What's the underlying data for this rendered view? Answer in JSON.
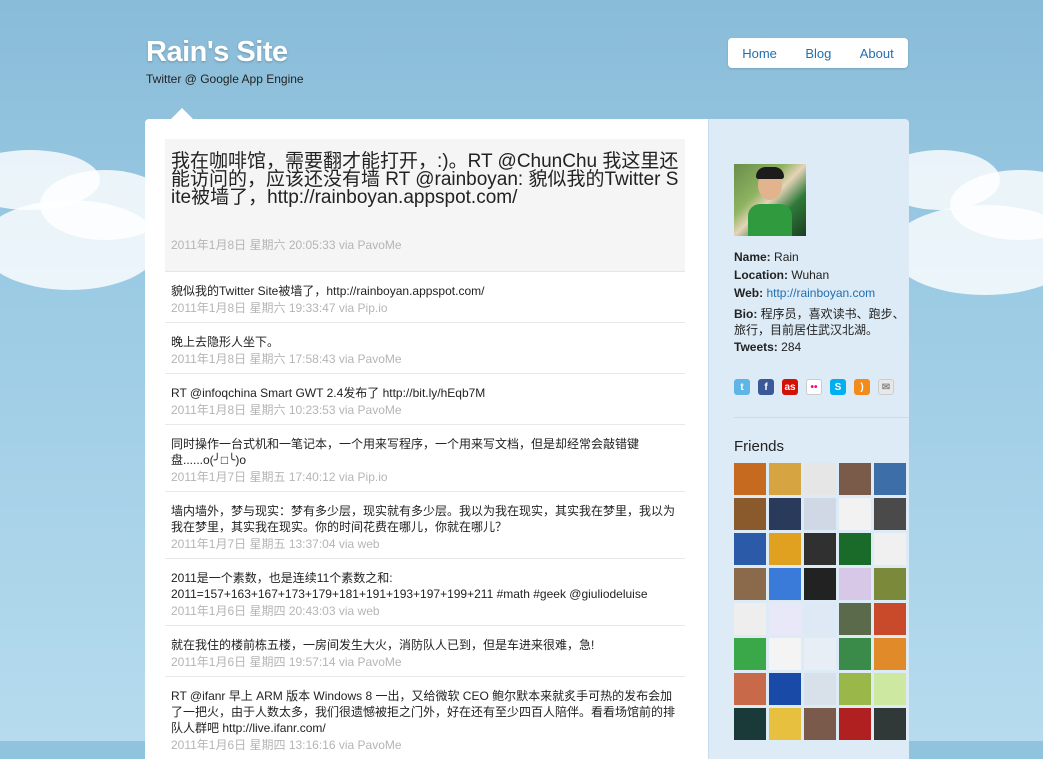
{
  "site": {
    "title": "Rain's Site",
    "subtitle": "Twitter @ Google App Engine"
  },
  "nav": [
    "Home",
    "Blog",
    "About"
  ],
  "featured": {
    "text": "我在咖啡馆，需要翻才能打开，:)。RT @ChunChu 我这里还能访问的，应该还没有墙 RT @rainboyan: 貌似我的Twitter Site被墙了，http://rainboyan.appspot.com/",
    "meta": "2011年1月8日 星期六 20:05:33 via PavoMe"
  },
  "tweets": [
    {
      "text": "貌似我的Twitter Site被墙了，http://rainboyan.appspot.com/",
      "meta": "2011年1月8日 星期六 19:33:47 via Pip.io"
    },
    {
      "text": "晚上去隐形人坐下。",
      "meta": "2011年1月8日 星期六 17:58:43 via PavoMe"
    },
    {
      "text": "RT @infoqchina Smart GWT 2.4发布了 http://bit.ly/hEqb7M",
      "meta": "2011年1月8日 星期六 10:23:53 via PavoMe"
    },
    {
      "text": "同时操作一台式机和一笔记本，一个用来写程序，一个用来写文档，但是却经常会敲错键盘......o(╯□╰)o",
      "meta": "2011年1月7日 星期五 17:40:12 via Pip.io"
    },
    {
      "text": "墙内墙外，梦与现实：梦有多少层，现实就有多少层。我以为我在现实，其实我在梦里，我以为我在梦里，其实我在现实。你的时间花费在哪儿，你就在哪儿？",
      "meta": "2011年1月7日 星期五 13:37:04 via web"
    },
    {
      "text": "2011是一个素数，也是连续11个素数之和: 2011=157+163+167+173+179+181+191+193+197+199+211 #math #geek @giuliodeluise",
      "meta": "2011年1月6日 星期四 20:43:03 via web"
    },
    {
      "text": "就在我住的楼前栋五楼，一房间发生大火，消防队人已到，但是车进来很难，急!",
      "meta": "2011年1月6日 星期四 19:57:14 via PavoMe"
    },
    {
      "text": "RT @ifanr 早上 ARM 版本 Windows 8 一出，又给微软 CEO 鲍尔默本来就炙手可热的发布会加了一把火，由于人数太多，我们很遗憾被拒之门外，好在还有至少四百人陪伴。看看场馆前的排队人群吧 http://live.ifanr.com/",
      "meta": "2011年1月6日 星期四 13:16:16 via PavoMe"
    }
  ],
  "profile": {
    "name_label": "Name:",
    "name": "Rain",
    "location_label": "Location:",
    "location": "Wuhan",
    "web_label": "Web:",
    "web": "http://rainboyan.com",
    "bio_label": "Bio:",
    "bio": "程序员，喜欢读书、跑步、旅行，目前居住武汉北湖。",
    "tweets_label": "Tweets:",
    "tweets": "284"
  },
  "social_icons": [
    "twitter-icon",
    "facebook-icon",
    "lastfm-icon",
    "flickr-icon",
    "skype-icon",
    "rss-icon",
    "mail-icon"
  ],
  "friends_title": "Friends",
  "friends": [
    "#c56a1e",
    "#d6a441",
    "#e6e6e6",
    "#7a5a48",
    "#3d6ea8",
    "#8a5a2c",
    "#2a3a5a",
    "#cfd8e4",
    "#f2f2f2",
    "#4a4a4a",
    "#2a5aa8",
    "#e0a020",
    "#303030",
    "#1a6a2a",
    "#f0f0f0",
    "#8a6a4a",
    "#3a7ad8",
    "#222222",
    "#d8c8e8",
    "#7a8a3a",
    "#eeeeee",
    "#e8e8f8",
    "#dfe9f5",
    "#5a6a4a",
    "#c84a2a",
    "#3aa848",
    "#f4f4f4",
    "#e8eef6",
    "#3a8a4a",
    "#e08a2a",
    "#c86a4a",
    "#1a4aa8",
    "#d8e0ea",
    "#9ab84a",
    "#cde8a0",
    "#1a3a3a",
    "#e8c040",
    "#7a5a4a",
    "#b02020",
    "#303838"
  ]
}
